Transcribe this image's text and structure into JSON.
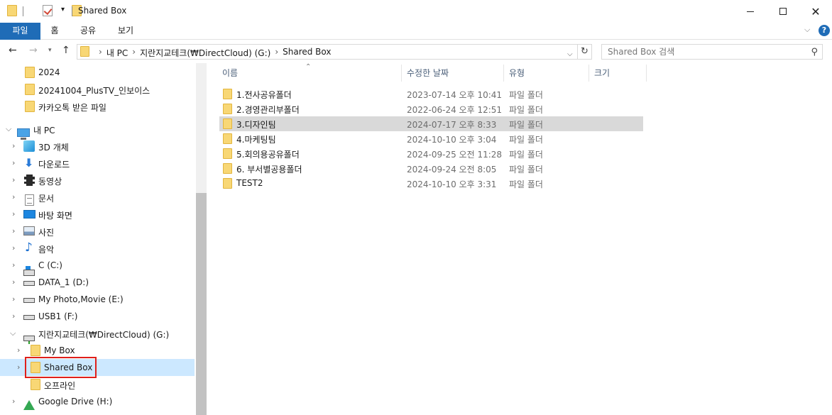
{
  "window": {
    "title": "Shared Box",
    "minimize": "—",
    "maximize": "□",
    "close": "✕"
  },
  "ribbon": {
    "tabs": [
      "파일",
      "홈",
      "공유",
      "보기"
    ],
    "expand_icon": "chevron-down-icon",
    "help_label": "?"
  },
  "address": {
    "crumbs": [
      "내 PC",
      "지란지교테크(₩DirectCloud) (G:)",
      "Shared Box"
    ],
    "search_placeholder": "Shared Box 검색"
  },
  "nav": {
    "items": [
      {
        "label": "2024",
        "icon": "folder-icon"
      },
      {
        "label": "20241004_PlusTV_인보이스",
        "icon": "folder-icon"
      },
      {
        "label": "카카오톡 받은 파일",
        "icon": "folder-icon"
      },
      {
        "label": "내 PC",
        "icon": "pc-icon"
      },
      {
        "label": "3D 개체",
        "icon": "3d-objects-icon"
      },
      {
        "label": "다운로드",
        "icon": "download-icon"
      },
      {
        "label": "동영상",
        "icon": "video-icon"
      },
      {
        "label": "문서",
        "icon": "document-icon"
      },
      {
        "label": "바탕 화면",
        "icon": "desktop-icon"
      },
      {
        "label": "사진",
        "icon": "pictures-icon"
      },
      {
        "label": "음악",
        "icon": "music-icon"
      },
      {
        "label": "C (C:)",
        "icon": "windows-drive-icon"
      },
      {
        "label": "DATA_1 (D:)",
        "icon": "drive-icon"
      },
      {
        "label": "My Photo,Movie (E:)",
        "icon": "drive-icon"
      },
      {
        "label": "USB1 (F:)",
        "icon": "drive-icon"
      },
      {
        "label": "지란지교테크(₩DirectCloud) (G:)",
        "icon": "network-drive-icon"
      },
      {
        "label": "My Box",
        "icon": "folder-icon"
      },
      {
        "label": "Shared Box",
        "icon": "folder-icon"
      },
      {
        "label": "오프라인",
        "icon": "folder-icon"
      },
      {
        "label": "Google Drive (H:)",
        "icon": "google-drive-icon"
      }
    ]
  },
  "columns": [
    "이름",
    "수정한 날짜",
    "유형",
    "크기"
  ],
  "files": [
    {
      "name": "1.전사공유폴더",
      "date": "2023-07-14 오후 10:41",
      "type": "파일 폴더"
    },
    {
      "name": "2.경영관리부폴더",
      "date": "2022-06-24 오후 12:51",
      "type": "파일 폴더"
    },
    {
      "name": "3.디자인팀",
      "date": "2024-07-17 오후 8:33",
      "type": "파일 폴더"
    },
    {
      "name": "4.마케팅팀",
      "date": "2024-10-10 오후 3:04",
      "type": "파일 폴더"
    },
    {
      "name": "5.회의용공유폴더",
      "date": "2024-09-25 오전 11:28",
      "type": "파일 폴더"
    },
    {
      "name": "6. 부서별공용폴더",
      "date": "2024-09-24 오전 8:05",
      "type": "파일 폴더"
    },
    {
      "name": "TEST2",
      "date": "2024-10-10 오후 3:31",
      "type": "파일 폴더"
    }
  ],
  "colors": {
    "accent": "#1f6cb7",
    "selection": "#cce8ff",
    "row_selected": "#d9d9d9",
    "highlight_box": "#e0201a"
  }
}
